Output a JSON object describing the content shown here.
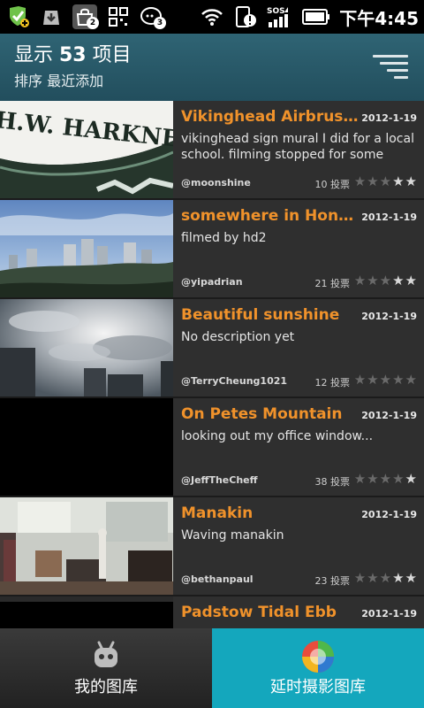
{
  "status_bar": {
    "time": "下午4:45",
    "icons": [
      "shield-plus-icon",
      "download-icon",
      "bag-icon",
      "grid-icon",
      "chat-icon",
      "wifi-icon",
      "phone-alert-icon",
      "sos-signal-icon",
      "battery-icon"
    ],
    "badges": {
      "bag": "2",
      "chat": "3"
    },
    "sos_label": "SOS"
  },
  "header": {
    "title_prefix": "显示 ",
    "title_count": "53",
    "title_suffix": " 项目",
    "subtitle": "排序 最近添加"
  },
  "videos": [
    {
      "title": "Vikinghead Airbrush Mural",
      "date": "2012-1-19",
      "description": "vikinghead sign mural I did for a local school.  filming stopped for some reason",
      "user": "@moonshine",
      "votes": "10 投票",
      "rating": 2
    },
    {
      "title": "somewhere in Hong Kong",
      "date": "2012-1-19",
      "description": "filmed by hd2",
      "user": "@yipadrian",
      "votes": "21 投票",
      "rating": 2
    },
    {
      "title": "Beautiful sunshine",
      "date": "2012-1-19",
      "description": "No description yet",
      "user": "@TerryCheung1021",
      "votes": "12 投票",
      "rating": 0
    },
    {
      "title": "On Petes Mountain",
      "date": "2012-1-19",
      "description": "looking out my office window...",
      "user": "@JeffTheCheff",
      "votes": "38 投票",
      "rating": 1
    },
    {
      "title": "Manakin",
      "date": "2012-1-19",
      "description": "Waving manakin",
      "user": "@bethanpaul",
      "votes": "23 投票",
      "rating": 2
    },
    {
      "title": "Padstow Tidal Ebb",
      "date": "2012-1-19",
      "description": "",
      "user": "",
      "votes": "",
      "rating": 0
    }
  ],
  "thumb_text": "H.W. HARKNES",
  "bottom_nav": {
    "my_gallery": "我的图库",
    "timelapse_gallery": "延时摄影图库"
  }
}
